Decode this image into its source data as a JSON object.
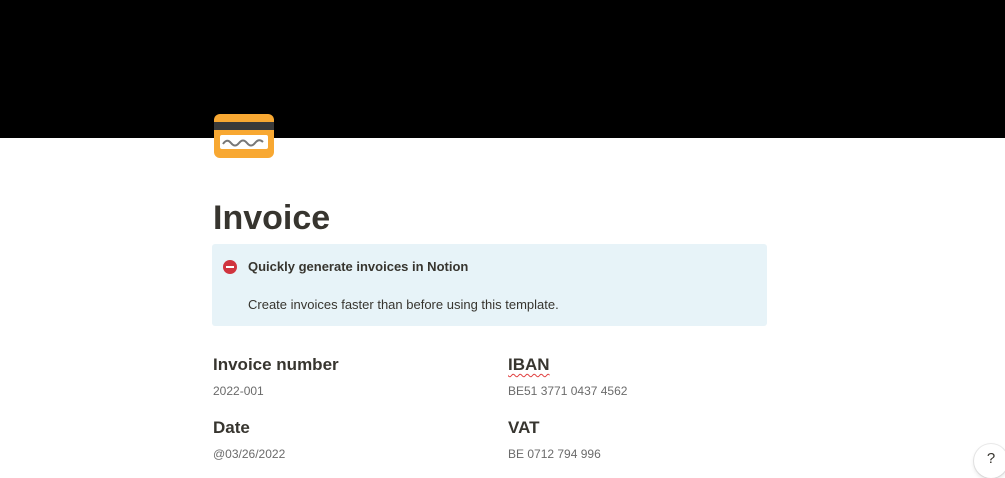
{
  "page": {
    "icon": "credit-card-icon",
    "title": "Invoice"
  },
  "callout": {
    "icon": "no-entry-icon",
    "title": "Quickly generate invoices in Notion",
    "body": "Create invoices faster than before using this template."
  },
  "fields": {
    "invoice_number": {
      "label": "Invoice number",
      "value": "2022-001"
    },
    "iban": {
      "label": "IBAN",
      "value": "BE51 3771 0437 4562"
    },
    "date": {
      "label": "Date",
      "value": "@03/26/2022"
    },
    "vat": {
      "label": "VAT",
      "value": "BE 0712 794 996"
    }
  },
  "help": {
    "label": "?"
  },
  "colors": {
    "cover": "#000000",
    "callout_bg": "#e7f3f8",
    "text": "#37352f",
    "muted": "#6b6b6b",
    "accent_red": "#d0343f"
  }
}
